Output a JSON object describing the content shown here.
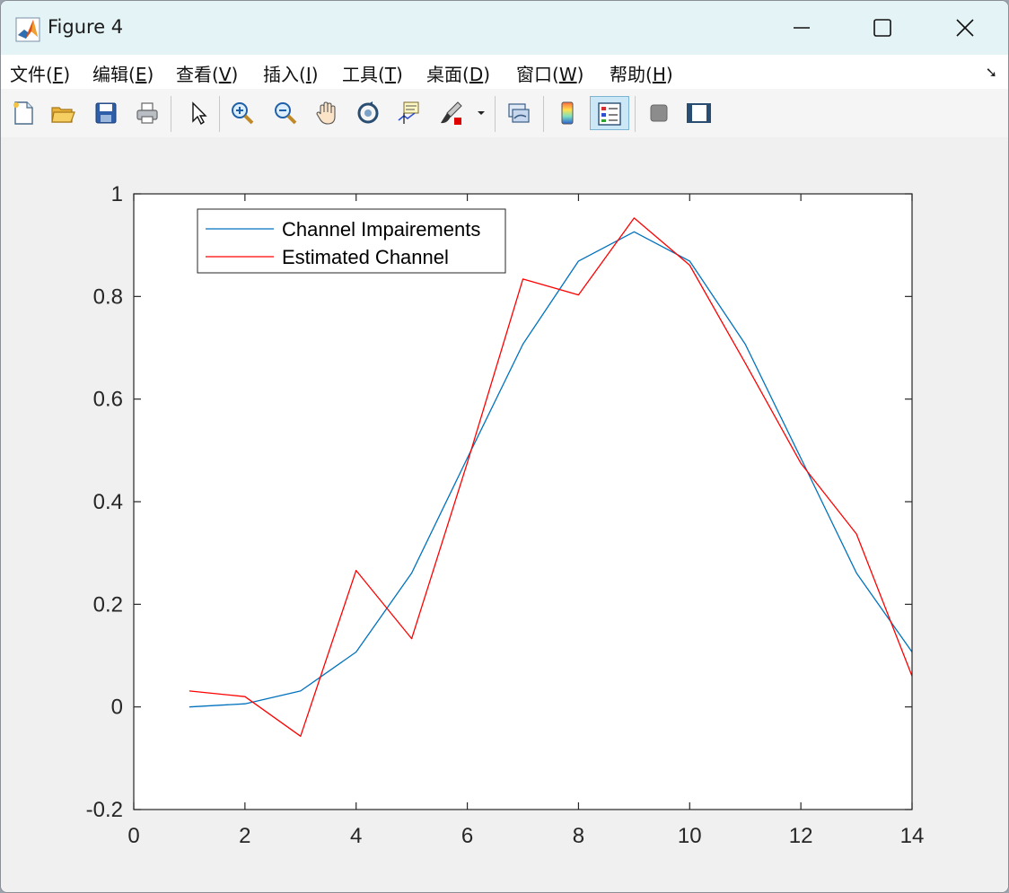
{
  "window": {
    "title": "Figure 4"
  },
  "menu": [
    {
      "label": "文件",
      "key": "F"
    },
    {
      "label": "编辑",
      "key": "E"
    },
    {
      "label": "查看",
      "key": "V"
    },
    {
      "label": "插入",
      "key": "I"
    },
    {
      "label": "工具",
      "key": "T"
    },
    {
      "label": "桌面",
      "key": "D"
    },
    {
      "label": "窗口",
      "key": "W"
    },
    {
      "label": "帮助",
      "key": "H"
    }
  ],
  "toolbar": {
    "icons": [
      "new-figure-icon",
      "open-file-icon",
      "save-icon",
      "print-icon",
      "edit-plot-icon",
      "zoom-in-icon",
      "zoom-out-icon",
      "pan-icon",
      "rotate-3d-icon",
      "data-cursor-icon",
      "brush-icon",
      "link-plot-icon",
      "colorbar-icon",
      "legend-icon",
      "hide-plot-tools-icon",
      "show-plot-tools-icon"
    ],
    "active": "legend-icon"
  },
  "chart_data": {
    "type": "line",
    "title": "",
    "xlabel": "",
    "ylabel": "",
    "xlim": [
      0,
      14
    ],
    "ylim": [
      -0.2,
      1
    ],
    "xticks": [
      "0",
      "2",
      "4",
      "6",
      "8",
      "10",
      "12",
      "14"
    ],
    "yticks": [
      "-0.2",
      "0",
      "0.2",
      "0.4",
      "0.6",
      "0.8",
      "1"
    ],
    "grid": false,
    "legend_position": "top-left",
    "x": [
      1,
      2,
      3,
      4,
      5,
      6,
      7,
      8,
      9,
      10,
      11,
      12,
      13,
      14
    ],
    "series": [
      {
        "name": "Channel Impairements",
        "color": "#0072bd",
        "values": [
          0.0,
          0.006,
          0.031,
          0.107,
          0.261,
          0.485,
          0.707,
          0.869,
          0.926,
          0.869,
          0.707,
          0.485,
          0.261,
          0.107
        ]
      },
      {
        "name": "Estimated Channel",
        "color": "#ff0000",
        "values": [
          0.031,
          0.02,
          -0.057,
          0.266,
          0.133,
          0.476,
          0.834,
          0.803,
          0.953,
          0.861,
          0.67,
          0.475,
          0.337,
          0.06
        ]
      }
    ]
  }
}
